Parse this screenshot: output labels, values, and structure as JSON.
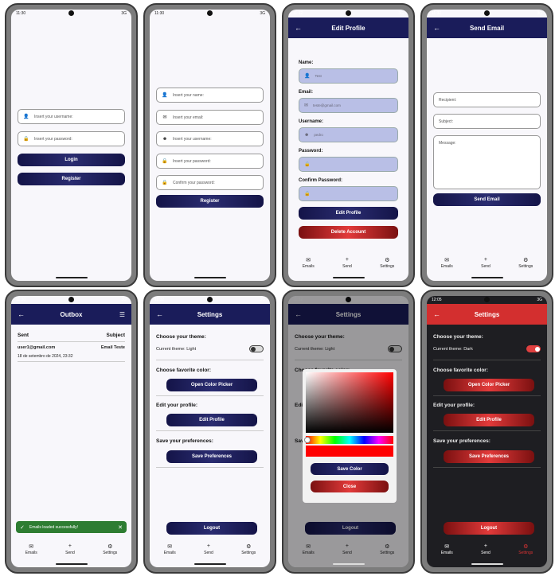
{
  "status": {
    "time": "11:30",
    "time2": "11:32",
    "time3": "12:05",
    "net": "3G"
  },
  "login": {
    "username_placeholder": "Insert your username:",
    "password_placeholder": "Insert your password:",
    "login_label": "Login",
    "register_label": "Register"
  },
  "register": {
    "name_placeholder": "Insert your name:",
    "email_placeholder": "Insert your email:",
    "username_placeholder": "Insert your username:",
    "password_placeholder": "Insert your password:",
    "confirm_placeholder": "Confirm your password:",
    "register_label": "Register"
  },
  "edit_profile": {
    "title": "Edit Profile",
    "name_label": "Name:",
    "name_value": "Test",
    "email_label": "Email:",
    "email_value": "teste@gmail.com",
    "username_label": "Username:",
    "username_value": "pedro",
    "password_label": "Password:",
    "confirm_label": "Confirm Password:",
    "edit_label": "Edit Profile",
    "delete_label": "Delete Account"
  },
  "send_email": {
    "title": "Send Email",
    "recipient_placeholder": "Recipient:",
    "subject_placeholder": "Subject:",
    "message_placeholder": "Message:",
    "send_label": "Send Email"
  },
  "outbox": {
    "title": "Outbox",
    "col_sent": "Sent",
    "col_subject": "Subject",
    "row_email": "user1@gmail.com",
    "row_date": "18 de setembro de 2024, 23:32",
    "row_subject": "Email Teste",
    "toast": "Emails loaded successfully!"
  },
  "settings": {
    "title": "Settings",
    "theme_heading": "Choose your theme:",
    "theme_light": "Current theme: Light",
    "theme_dark": "Current theme: Dark",
    "color_heading": "Choose favorite color:",
    "color_button": "Open Color Picker",
    "profile_heading": "Edit your profile:",
    "profile_button": "Edit Profile",
    "prefs_heading": "Save your preferences:",
    "prefs_button": "Save Preferences",
    "logout": "Logout"
  },
  "picker": {
    "save": "Save Color",
    "close": "Close"
  },
  "nav": {
    "emails": "Emails",
    "send": "Send",
    "settings": "Settings"
  },
  "colors": {
    "navy": "#1a1c5a",
    "red": "#d32f2f",
    "dark_bg": "#1e1e22"
  }
}
